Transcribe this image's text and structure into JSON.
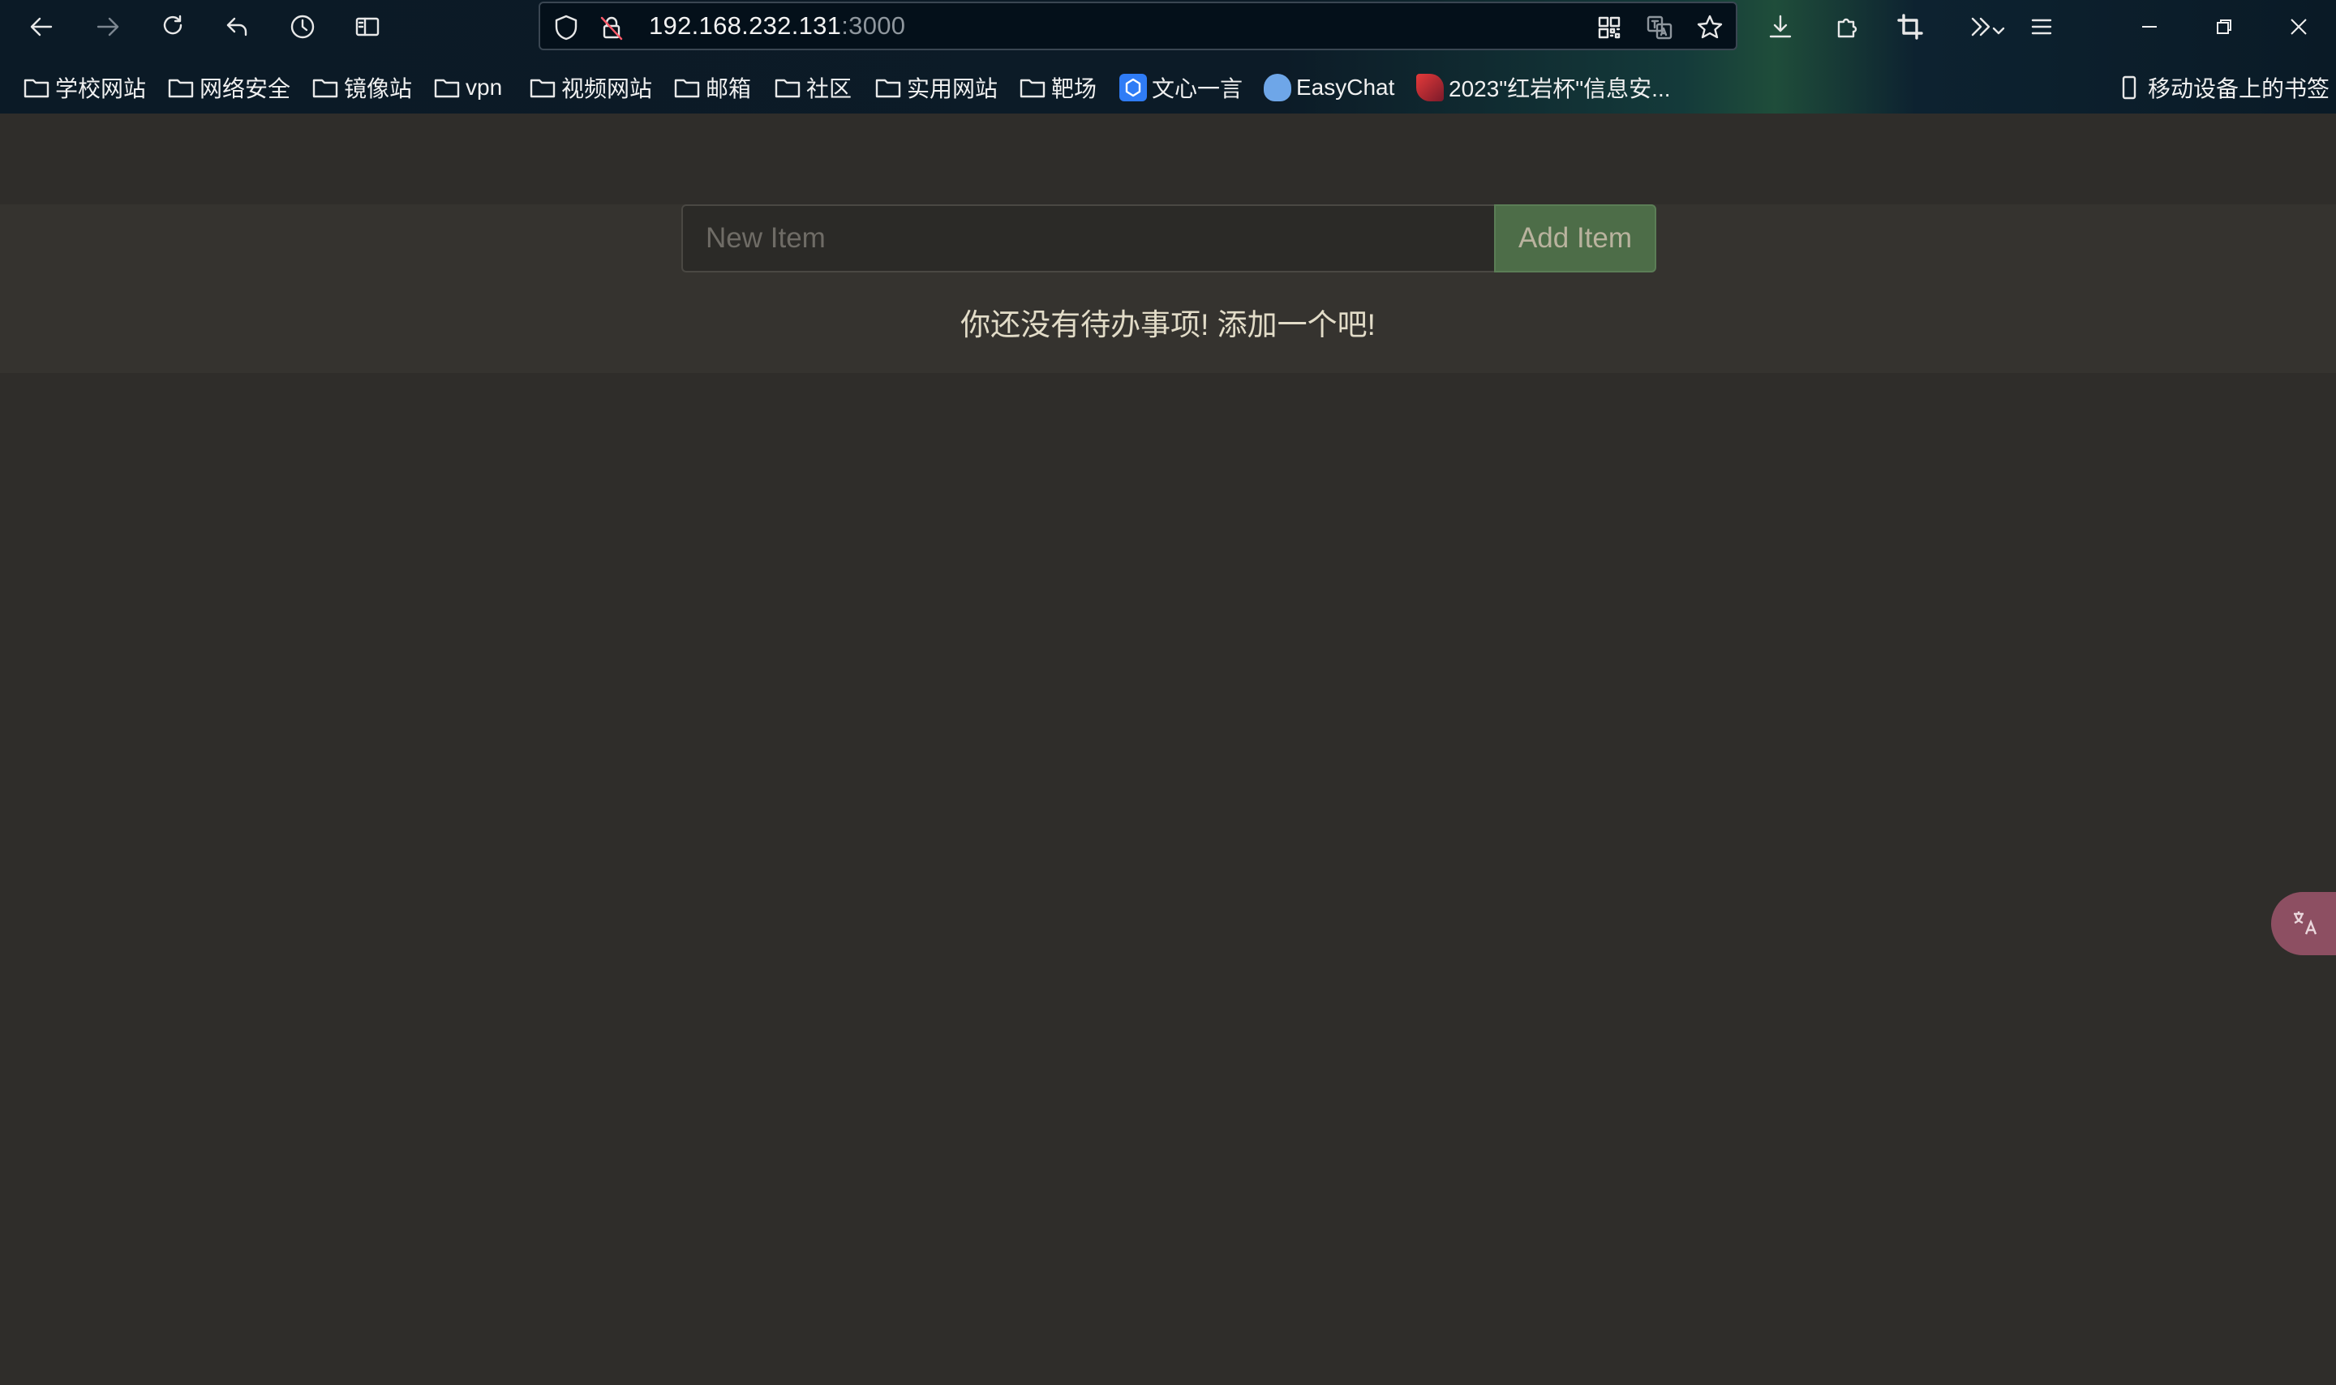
{
  "browser": {
    "url_host": "192.168.232.131",
    "url_port": ":3000",
    "bookmarks": [
      {
        "label": "学校网站",
        "icon": "folder-icon"
      },
      {
        "label": "网络安全",
        "icon": "folder-icon"
      },
      {
        "label": "镜像站",
        "icon": "folder-icon"
      },
      {
        "label": "vpn",
        "icon": "folder-icon"
      },
      {
        "label": "视频网站",
        "icon": "folder-icon"
      },
      {
        "label": "邮箱",
        "icon": "folder-icon"
      },
      {
        "label": "社区",
        "icon": "folder-icon"
      },
      {
        "label": "实用网站",
        "icon": "folder-icon"
      },
      {
        "label": "靶场",
        "icon": "folder-icon"
      },
      {
        "label": "文心一言",
        "icon": "wenxin-favicon"
      },
      {
        "label": "EasyChat",
        "icon": "easychat-favicon"
      },
      {
        "label": "2023\"红岩杯\"信息安...",
        "icon": "hongyan-favicon"
      }
    ],
    "mobile_bookmarks": "移动设备上的书签"
  },
  "todo": {
    "input_placeholder": "New Item",
    "input_value": "",
    "add_button": "Add Item",
    "empty_message": "你还没有待办事项! 添加一个吧!"
  },
  "colors": {
    "page_bg": "#2f2d2a",
    "band_bg": "#35332f",
    "add_button_bg": "#4d6d48",
    "message_text": "#e2dcc8"
  }
}
